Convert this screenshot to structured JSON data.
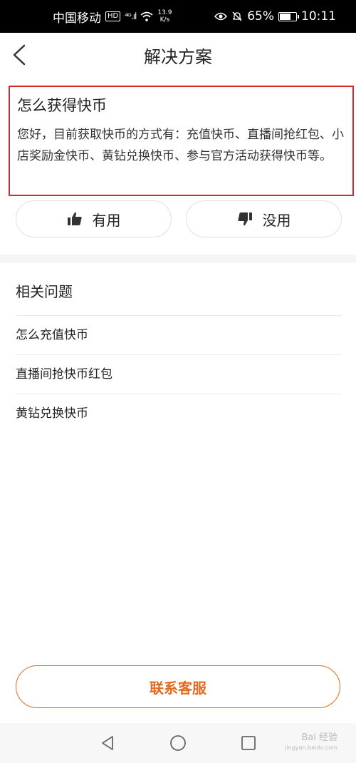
{
  "status_bar": {
    "carrier": "中国移动",
    "network_badge": "HD",
    "signal": "⁴ᴳ.ıl",
    "speed_value": "13.9",
    "speed_unit": "K/s",
    "battery": "65%",
    "time": "10:11"
  },
  "nav": {
    "title": "解决方案"
  },
  "solution": {
    "title": "怎么获得快币",
    "body": "您好，目前获取快币的方式有：充值快币、直播间抢红包、小店奖励金快币、黄钻兑换快币、参与官方活动获得快币等。"
  },
  "feedback": {
    "useful_label": "有用",
    "useless_label": "没用"
  },
  "related": {
    "title": "相关问题",
    "items": [
      "怎么充值快币",
      "直播间抢快币红包",
      "黄钻兑换快币"
    ]
  },
  "contact_label": "联系客服",
  "watermark": {
    "main": "Bai 经验",
    "sub": "jingyan.baidu.com"
  },
  "colors": {
    "accent": "#e46a1f",
    "highlight_border": "#d8282e"
  }
}
